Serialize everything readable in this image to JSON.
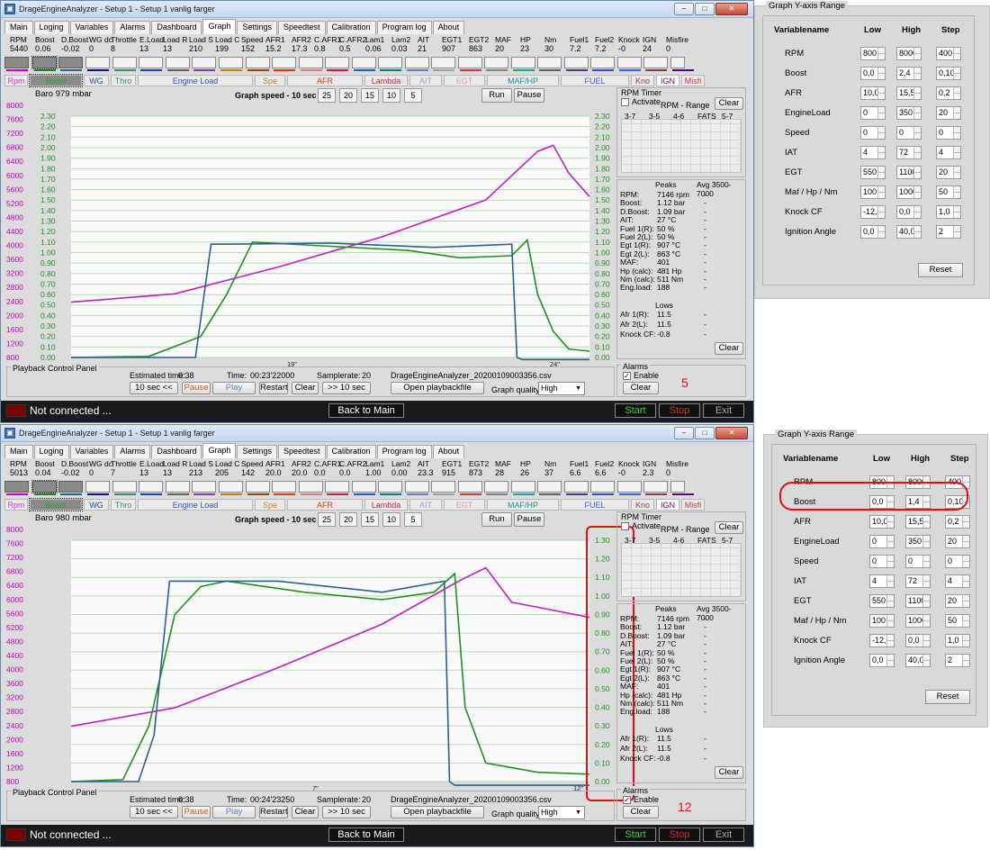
{
  "app": {
    "title": "DrageEngineAnalyzer - Setup 1 - Setup 1 vanlig farger",
    "tabs": [
      "Main",
      "Loging",
      "Variables",
      "Alarms",
      "Dashboard",
      "Graph",
      "Settings",
      "Speedtest",
      "Calibration",
      "Program log",
      "About"
    ],
    "active_tab": "Graph"
  },
  "var_names": [
    "RPM",
    "Boost",
    "D.Boost",
    "WG dc",
    "Throttle",
    "E.Load",
    "Load R",
    "Load S",
    "Load C",
    "Speed",
    "AFR1",
    "AFR2",
    "C.AFR1",
    "C.AFR2",
    "Lam1",
    "Lam2",
    "AIT",
    "EGT1",
    "EGT2",
    "MAF",
    "HP",
    "Nm",
    "Fuel1",
    "Fuel2",
    "Knock",
    "IGN",
    "Misfire"
  ],
  "group_buttons": [
    "Rpm",
    "Boost",
    "WG",
    "Thro",
    "Engine Load",
    "Spe",
    "AFR",
    "Lambda",
    "AIT",
    "EGT",
    "MAF/HP",
    "FUEL",
    "Kno",
    "IGN",
    "Misfi"
  ],
  "group_colors": [
    "#c040c0",
    "#30a030",
    "#2050a0",
    "#3a8a7a",
    "#3050c0",
    "#c08030",
    "#d04000",
    "#d02040",
    "#a0a0e0",
    "#e0a0a0",
    "#209090",
    "#4060e0",
    "#904040",
    "#800080",
    "#c04040"
  ],
  "graph_speed_label": "Graph speed - 10 sec",
  "speed_buttons": [
    "25",
    "20",
    "15",
    "10",
    "5"
  ],
  "run_label": "Run",
  "pause_label": "Pause",
  "rpm_timer": {
    "title": "RPM Timer",
    "activate": "Activate",
    "range": "RPM - Range",
    "clear": "Clear",
    "cols": [
      "3-7",
      "3-5",
      "4-6",
      "FATS",
      "5-7"
    ]
  },
  "peaks": {
    "peaks_label": "Peaks",
    "avg_label": "Avg 3500-7000",
    "lows_label": "Lows",
    "rows": [
      {
        "k": "RPM:",
        "v": "7146 rpm"
      },
      {
        "k": "Boost:",
        "v": "1.12 bar"
      },
      {
        "k": "D.Boost:",
        "v": "1.09 bar"
      },
      {
        "k": "AIT:",
        "v": "27 °C"
      },
      {
        "k": "Fuel 1(R):",
        "v": "50 %"
      },
      {
        "k": "Fuel 2(L):",
        "v": "50 %"
      },
      {
        "k": "Egt 1(R):",
        "v": "907 °C"
      },
      {
        "k": "Egt 2(L):",
        "v": "863 °C"
      },
      {
        "k": "MAF:",
        "v": "401"
      },
      {
        "k": "Hp (calc):",
        "v": "481 Hp"
      },
      {
        "k": "Nm (calc):",
        "v": "511 Nm"
      },
      {
        "k": "Eng.load:",
        "v": "188"
      }
    ],
    "low_rows": [
      {
        "k": "Afr 1(R):",
        "v": "11.5"
      },
      {
        "k": "Afr 2(L):",
        "v": "11.5"
      },
      {
        "k": "Knock CF:",
        "v": "-0.8"
      }
    ],
    "clear": "Clear"
  },
  "alarms": {
    "title": "Alarms",
    "enable": "Enable",
    "clear": "Clear"
  },
  "playback": {
    "title": "Playback Control Panel",
    "estimated_label": "Estimated time:",
    "estimated": "0:38",
    "time_label": "Time:",
    "samplerate_label": "Samplerate:",
    "samplerate": "20",
    "filename": "DrageEngineAnalyzer_20200109003356.csv",
    "buttons": [
      "10 sec <<",
      "Pause",
      "Play",
      "Restart",
      "Clear",
      ">> 10 sec"
    ],
    "open": "Open playbackfile",
    "quality_label": "Graph quality:",
    "quality": "High"
  },
  "status": {
    "text": "Not connected ...",
    "back": "Back to Main",
    "start": "Start",
    "stop": "Stop",
    "exit": "Exit"
  },
  "rpm_ticks": [
    "8000",
    "7600",
    "7200",
    "6800",
    "6400",
    "6000",
    "5600",
    "5200",
    "4800",
    "4400",
    "4000",
    "3600",
    "3200",
    "2800",
    "2400",
    "2000",
    "1600",
    "1200",
    "800"
  ],
  "window1": {
    "vals": [
      "5440",
      "0.06",
      "-0.02",
      "0",
      "8",
      "13",
      "13",
      "210",
      "199",
      "152",
      "15.2",
      "17.3",
      "0.8",
      "0.5",
      "0.06",
      "0.03",
      "21",
      "907",
      "863",
      "20",
      "23",
      "30",
      "7.2",
      "7.2",
      "-0",
      "24",
      "0"
    ],
    "baro": "Baro  979 mbar",
    "time": "00:23'22000",
    "boost_ticks": [
      "2.30",
      "2.20",
      "2.10",
      "2.00",
      "1.90",
      "1.80",
      "1.70",
      "1.60",
      "1.50",
      "1.40",
      "1.30",
      "1.20",
      "1.10",
      "1.00",
      "0.90",
      "0.80",
      "0.70",
      "0.60",
      "0.50",
      "0.40",
      "0.30",
      "0.20",
      "0.10",
      "0.00"
    ],
    "x_labels": [
      "19\"",
      "24\""
    ],
    "annotation": "5",
    "chart_data": {
      "type": "line",
      "ylim_rpm": [
        800,
        8000
      ],
      "ylim_boost": [
        0,
        2.3
      ],
      "series": [
        {
          "name": "RPM",
          "color": "#c020c0",
          "x": [
            0,
            0.2,
            0.4,
            0.6,
            0.8,
            0.9,
            0.93,
            0.96,
            1.0
          ],
          "y": [
            2450,
            2700,
            3500,
            4400,
            5500,
            6950,
            7130,
            6300,
            5600
          ]
        },
        {
          "name": "Boost",
          "color": "#209020",
          "x": [
            0,
            0.15,
            0.25,
            0.3,
            0.35,
            0.5,
            0.65,
            0.75,
            0.85,
            0.88,
            0.9,
            0.93,
            0.96,
            1.0
          ],
          "y": [
            0.0,
            0.01,
            0.2,
            0.6,
            1.1,
            1.06,
            1.02,
            0.95,
            0.97,
            1.12,
            0.6,
            0.25,
            0.08,
            0.06
          ]
        },
        {
          "name": "D.Boost",
          "color": "#2a6090",
          "x": [
            0,
            0.24,
            0.27,
            0.3,
            0.5,
            0.7,
            0.85,
            0.86,
            0.87,
            1.0
          ],
          "y": [
            0.0,
            0.0,
            1.08,
            1.08,
            1.09,
            1.05,
            1.08,
            0.0,
            -0.02,
            -0.02
          ]
        }
      ]
    }
  },
  "window2": {
    "vals": [
      "5013",
      "0.04",
      "-0.02",
      "0",
      "7",
      "13",
      "13",
      "213",
      "205",
      "142",
      "20.0",
      "20.0",
      "0.0",
      "0.0",
      "1.00",
      "0.00",
      "23.3",
      "915",
      "873",
      "28",
      "26",
      "37",
      "6.6",
      "6.6",
      "-0",
      "2.3",
      "0"
    ],
    "baro": "Baro  980 mbar",
    "time": "00:24'23250",
    "boost_ticks": [
      "1.30",
      "1.20",
      "1.10",
      "1.00",
      "0.90",
      "0.80",
      "0.70",
      "0.60",
      "0.50",
      "0.40",
      "0.30",
      "0.20",
      "0.10",
      "0.00"
    ],
    "x_labels": [
      "7\"",
      "12\""
    ],
    "annotation": "12",
    "chart_data": {
      "type": "line",
      "ylim_rpm": [
        800,
        8000
      ],
      "ylim_boost": [
        0,
        1.3
      ],
      "series": [
        {
          "name": "RPM",
          "color": "#c020c0",
          "x": [
            0,
            0.2,
            0.4,
            0.6,
            0.75,
            0.8,
            0.85,
            0.9,
            1.0
          ],
          "y": [
            2450,
            3000,
            4200,
            5500,
            6800,
            7180,
            6150,
            6000,
            5700
          ]
        },
        {
          "name": "Boost",
          "color": "#209020",
          "x": [
            0,
            0.1,
            0.15,
            0.2,
            0.25,
            0.3,
            0.45,
            0.6,
            0.7,
            0.74,
            0.76,
            0.8,
            0.9,
            1.0
          ],
          "y": [
            0.0,
            0.01,
            0.3,
            0.9,
            1.05,
            1.08,
            1.02,
            0.98,
            1.02,
            1.12,
            0.4,
            0.1,
            0.05,
            0.04
          ]
        },
        {
          "name": "D.Boost",
          "color": "#2a6090",
          "x": [
            0,
            0.13,
            0.16,
            0.19,
            0.4,
            0.6,
            0.72,
            0.73,
            0.74,
            1.0
          ],
          "y": [
            0.0,
            0.0,
            0.25,
            1.08,
            1.08,
            1.02,
            1.08,
            0.0,
            -0.02,
            -0.02
          ]
        }
      ]
    }
  },
  "yaxis": {
    "title": "Graph Y-axis Range",
    "headers": [
      "Variablename",
      "Low",
      "High",
      "Step"
    ],
    "reset": "Reset",
    "rows1": [
      [
        "RPM",
        "800",
        "8000",
        "400"
      ],
      [
        "Boost",
        "0,0",
        "2,4",
        "0,10"
      ],
      [
        "AFR",
        "10,0",
        "15,5",
        "0,2"
      ],
      [
        "EngineLoad",
        "0",
        "350",
        "20"
      ],
      [
        "Speed",
        "0",
        "0",
        "0"
      ],
      [
        "IAT",
        "4",
        "72",
        "4"
      ],
      [
        "EGT",
        "550",
        "1100",
        "20"
      ],
      [
        "Maf / Hp / Nm",
        "100",
        "1000",
        "50"
      ],
      [
        "Knock CF",
        "-12,0",
        "0,0",
        "1,0"
      ],
      [
        "Ignition Angle",
        "0,0",
        "40,0",
        "2"
      ]
    ],
    "rows2": [
      [
        "RPM",
        "800",
        "8000",
        "400"
      ],
      [
        "Boost",
        "0,0",
        "1,4",
        "0,10"
      ],
      [
        "AFR",
        "10,0",
        "15,5",
        "0,2"
      ],
      [
        "EngineLoad",
        "0",
        "350",
        "20"
      ],
      [
        "Speed",
        "0",
        "0",
        "0"
      ],
      [
        "IAT",
        "4",
        "72",
        "4"
      ],
      [
        "EGT",
        "550",
        "1100",
        "20"
      ],
      [
        "Maf / Hp / Nm",
        "100",
        "1000",
        "50"
      ],
      [
        "Knock CF",
        "-12,0",
        "0,0",
        "1,0"
      ],
      [
        "Ignition Angle",
        "0,0",
        "40,0",
        "2"
      ]
    ]
  },
  "colors": {
    "highlight": "#e01010",
    "rpm_axis": "#c000c0",
    "boost_axis": "#209020",
    "grid": "#b8d8b8"
  }
}
